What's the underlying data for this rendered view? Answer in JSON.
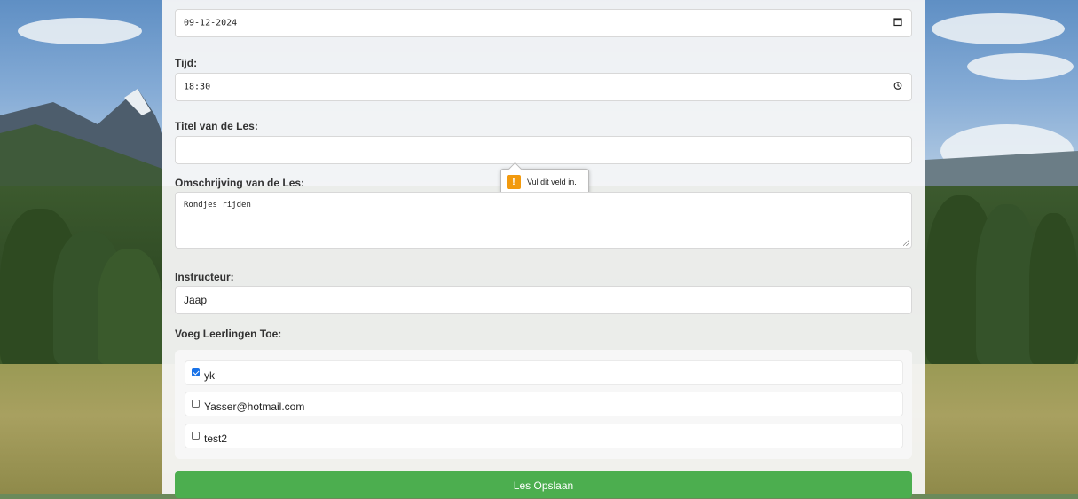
{
  "form": {
    "date": {
      "value": "09-12-2024",
      "icon": "calendar-icon"
    },
    "time": {
      "label": "Tijd:",
      "value": "18:30",
      "icon": "clock-icon"
    },
    "title": {
      "label": "Titel van de Les:",
      "value": ""
    },
    "description": {
      "label": "Omschrijving van de Les:",
      "value": "Rondjes rijden"
    },
    "instructor": {
      "label": "Instructeur:",
      "value": "Jaap"
    },
    "students": {
      "label": "Voeg Leerlingen Toe:",
      "items": [
        {
          "name": "yk",
          "checked": true
        },
        {
          "name": "Yasser@hotmail.com",
          "checked": false
        },
        {
          "name": "test2",
          "checked": false
        }
      ]
    },
    "save_label": "Les Opslaan"
  },
  "validation": {
    "message": "Vul dit veld in.",
    "icon": "warning-icon",
    "color": "#f29a0e"
  },
  "colors": {
    "save_button": "#4cae4f",
    "checkbox_checked": "#1a73e8"
  }
}
